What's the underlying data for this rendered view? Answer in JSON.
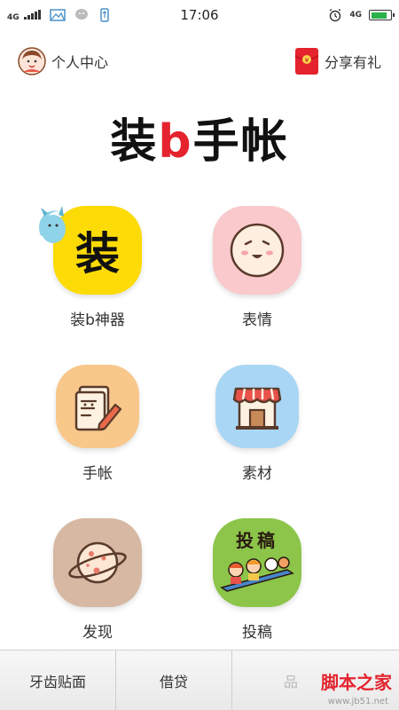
{
  "status_bar": {
    "network": "4G",
    "time": "17:06",
    "network_right": "4G",
    "battery_level": 0.85,
    "battery_color": "#2bb24c"
  },
  "header": {
    "left_label": "个人中心",
    "right_label": "分享有礼",
    "profile_icon": "avatar-icon",
    "gift_icon": "red-envelope-icon"
  },
  "title": {
    "part1": "装",
    "part2": "b",
    "part3": "手帐",
    "accent_color": "#e4232e"
  },
  "grid": [
    {
      "label": "装b神器",
      "icon": "zhuang-character-icon",
      "bg": "#fcdb06",
      "glyph": "装"
    },
    {
      "label": "表情",
      "icon": "smiley-face-icon",
      "bg": "#f9c9cc"
    },
    {
      "label": "手帐",
      "icon": "notebook-pencil-icon",
      "bg": "#f8c78a"
    },
    {
      "label": "素材",
      "icon": "shop-icon",
      "bg": "#a9d6f4"
    },
    {
      "label": "发现",
      "icon": "planet-icon",
      "bg": "#d6b8a3"
    },
    {
      "label": "投稿",
      "icon": "submission-icon",
      "bg": "#8cc54a",
      "glyph": "投稿"
    }
  ],
  "bottom_tabs": [
    {
      "label": "牙齿贴面"
    },
    {
      "label": "借贷"
    },
    {
      "label": "品"
    }
  ],
  "watermark": {
    "text": "脚本之家",
    "sub": "www.jb51.net"
  }
}
